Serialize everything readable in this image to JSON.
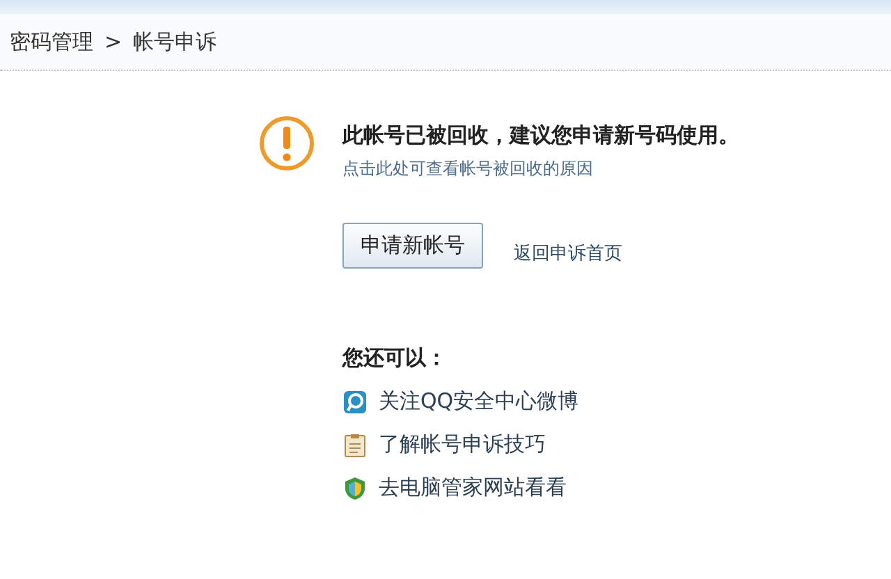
{
  "breadcrumb": {
    "items": [
      "密码管理",
      "帐号申诉"
    ],
    "separator": ">"
  },
  "notice": {
    "title": "此帐号已被回收，建议您申请新号码使用。",
    "link": "点击此处可查看帐号被回收的原因"
  },
  "actions": {
    "button": "申请新帐号",
    "link": "返回申诉首页"
  },
  "more": {
    "heading": "您还可以：",
    "items": [
      {
        "kind": "weibo",
        "label": "关注QQ安全中心微博"
      },
      {
        "kind": "notes",
        "label": "了解帐号申诉技巧"
      },
      {
        "kind": "shield",
        "label": "去电脑管家网站看看"
      }
    ]
  }
}
